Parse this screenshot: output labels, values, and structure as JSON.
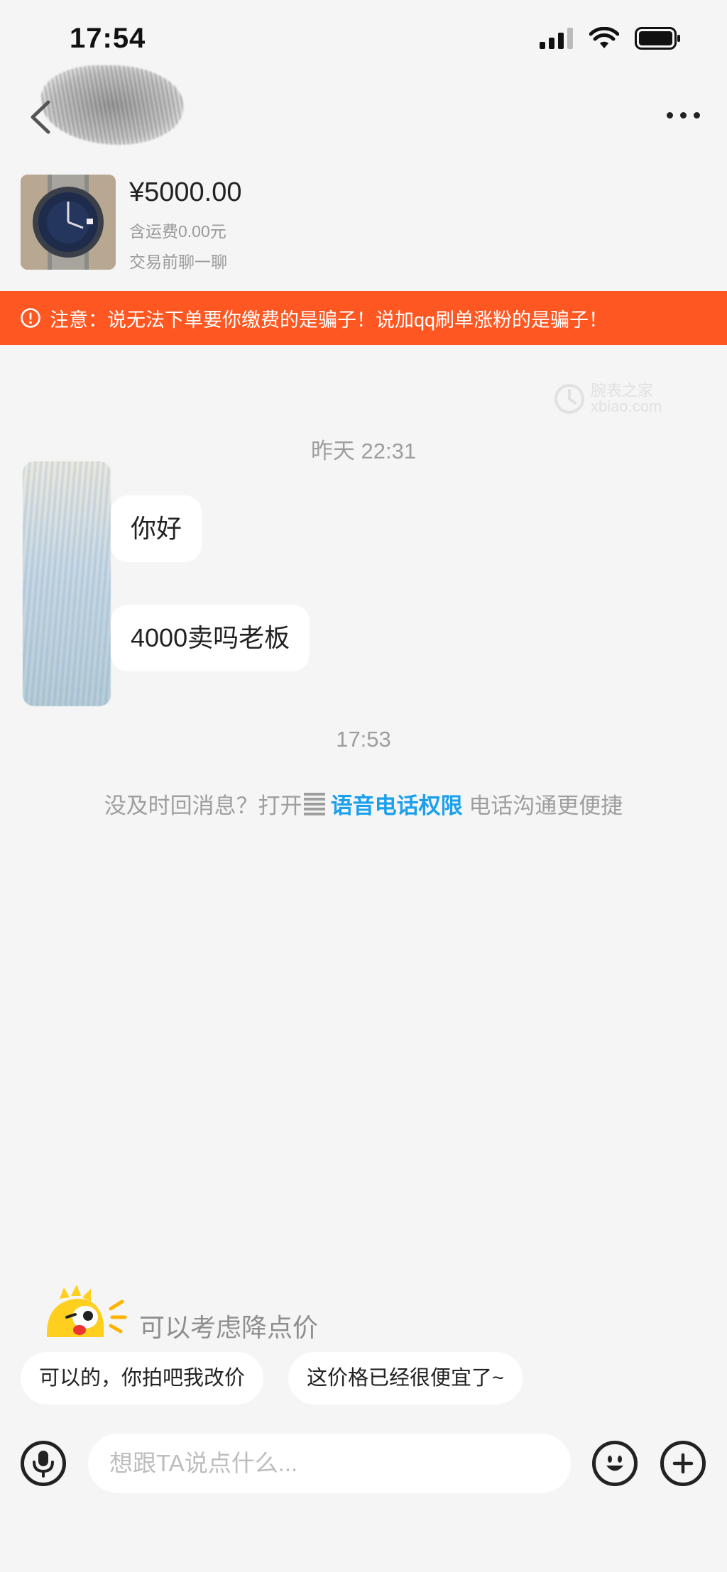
{
  "status_bar": {
    "time": "17:54"
  },
  "header": {
    "back_icon": "chevron-left-icon",
    "more_icon": "more-dots-icon"
  },
  "product": {
    "price": "¥5000.00",
    "shipping": "含运费0.00元",
    "hint": "交易前聊一聊"
  },
  "warning": {
    "icon": "alert-circle-icon",
    "text": "注意：说无法下单要你缴费的是骗子！说加qq刷单涨粉的是骗子！",
    "color": "#ff5722"
  },
  "watermark": {
    "line1": "腕表之家",
    "line2": "xbiao.com"
  },
  "chat": {
    "timestamps": [
      "昨天 22:31",
      "17:53"
    ],
    "messages": [
      {
        "text": "你好"
      },
      {
        "text": "4000卖吗老板"
      }
    ],
    "permission": {
      "prefix": "没及时回消息？打开",
      "link": "语音电话权限",
      "suffix": "电话沟通更便捷",
      "link_color": "#1aa0ec"
    }
  },
  "suggestions": {
    "title": "可以考虑降点价",
    "chips": [
      "可以的，你拍吧我改价",
      "这价格已经很便宜了~"
    ]
  },
  "input_bar": {
    "placeholder": "想跟TA说点什么...",
    "mic_icon": "microphone-icon",
    "emoji_icon": "emoji-icon",
    "plus_icon": "plus-icon"
  }
}
